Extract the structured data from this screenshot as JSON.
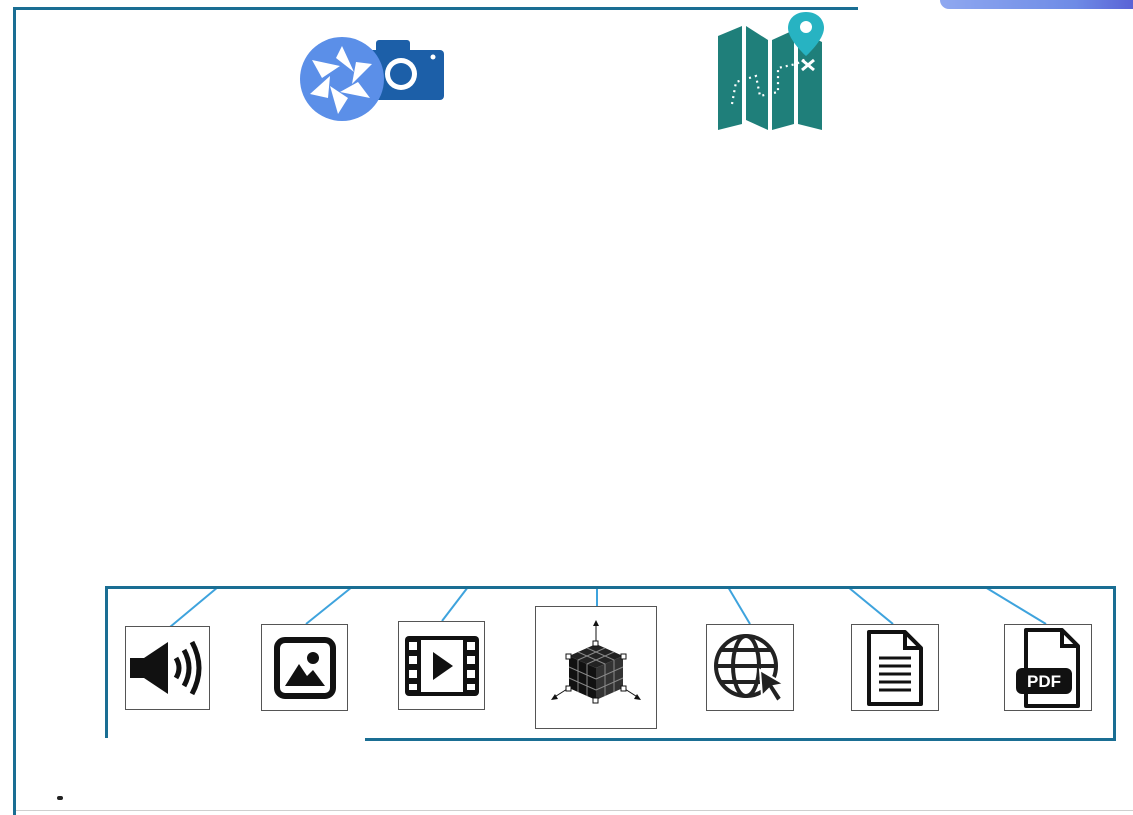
{
  "colors": {
    "frame": "#1a6e93",
    "connector": "#3ea3dd",
    "camera_shutter": "#5b8fe8",
    "camera_body": "#1c5fa8",
    "map_fill": "#1f7f7a",
    "map_pin": "#27b3c2",
    "icon_fill": "#111111"
  },
  "header_icons": [
    {
      "name": "camera-icon"
    },
    {
      "name": "map-icon"
    }
  ],
  "toolbar": {
    "items": [
      {
        "name": "audio-icon"
      },
      {
        "name": "image-icon"
      },
      {
        "name": "video-icon"
      },
      {
        "name": "3d-model-icon"
      },
      {
        "name": "web-link-icon"
      },
      {
        "name": "document-icon"
      },
      {
        "name": "pdf-icon",
        "label": "PDF"
      }
    ]
  }
}
